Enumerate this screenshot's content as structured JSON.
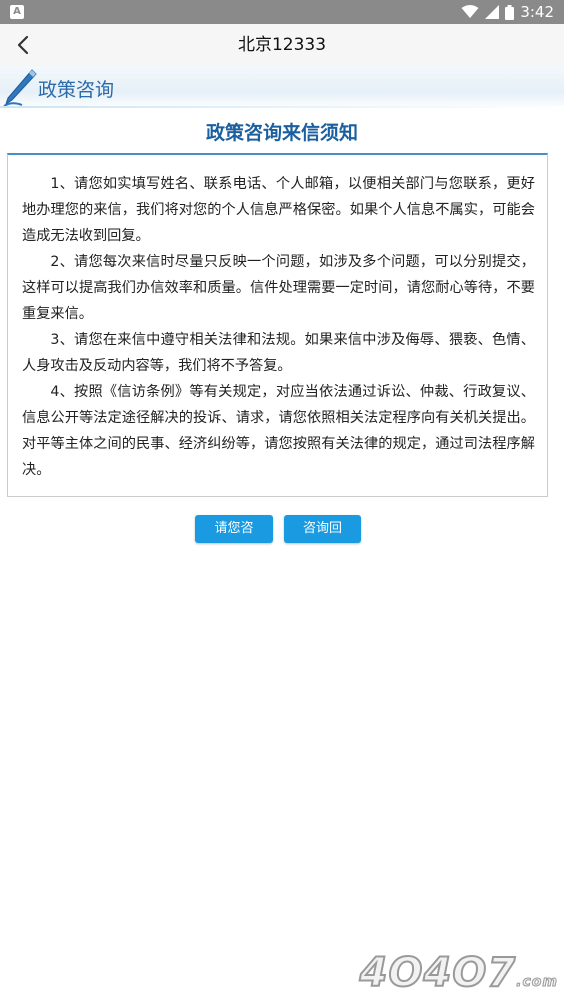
{
  "status_bar": {
    "app_icon_letter": "A",
    "time": "3:42",
    "icons": [
      "wifi-icon",
      "signal-icon",
      "battery-icon"
    ]
  },
  "app_bar": {
    "title": "北京12333",
    "back_icon": "chevron-left-icon"
  },
  "section": {
    "title": "政策咨询",
    "icon": "pen-icon"
  },
  "notice": {
    "title": "政策咨询来信须知",
    "paragraphs": [
      "1、请您如实填写姓名、联系电话、个人邮箱，以便相关部门与您联系，更好地办理您的来信，我们将对您的个人信息严格保密。如果个人信息不属实，可能会造成无法收到回复。",
      "2、请您每次来信时尽量只反映一个问题，如涉及多个问题，可以分别提交，这样可以提高我们办信效率和质量。信件处理需要一定时间，请您耐心等待，不要重复来信。",
      "3、请您在来信中遵守相关法律和法规。如果来信中涉及侮辱、猥亵、色情、人身攻击及反动内容等，我们将不予答复。",
      "4、按照《信访条例》等有关规定，对应当依法通过诉讼、仲裁、行政复议、信息公开等法定途径解决的投诉、请求，请您依照相关法定程序向有关机关提出。对平等主体之间的民事、经济纠纷等，请您按照有关法律的规定，通过司法程序解决。"
    ]
  },
  "buttons": {
    "consult_label": "请您咨询",
    "reply_label": "咨询回复"
  },
  "watermark": {
    "text": "4O4O7",
    "suffix": ".com"
  },
  "colors": {
    "accent": "#1a9be1",
    "title_blue": "#1b5f9e",
    "statusbar": "#8a8a8a"
  }
}
